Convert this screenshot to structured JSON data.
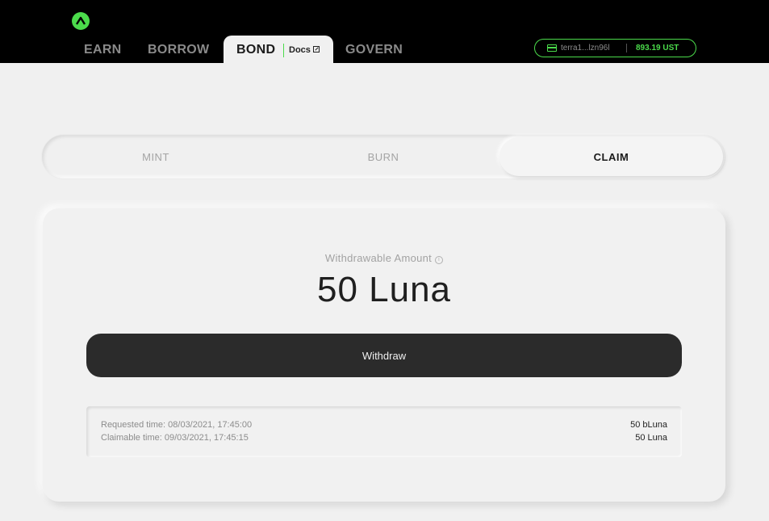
{
  "header": {
    "nav": {
      "earn": "EARN",
      "borrow": "BORROW",
      "bond": "BOND",
      "docs": "Docs",
      "govern": "GOVERN"
    },
    "wallet": {
      "address": "terra1...lzn96l",
      "balance": "893.19 UST"
    }
  },
  "tabs": {
    "mint": "MINT",
    "burn": "BURN",
    "claim": "CLAIM",
    "active": "claim"
  },
  "claim": {
    "label": "Withdrawable Amount",
    "amount": "50 Luna",
    "button": "Withdraw"
  },
  "history": [
    {
      "requested": "Requested time: 08/03/2021, 17:45:00",
      "claimable": "Claimable time: 09/03/2021, 17:45:15",
      "bluna": "50 bLuna",
      "luna": "50 Luna"
    }
  ],
  "colors": {
    "accent": "#4bdb4b",
    "header_bg": "#000000",
    "page_bg": "#f0f0f0",
    "button_bg": "#2b2b2b"
  }
}
